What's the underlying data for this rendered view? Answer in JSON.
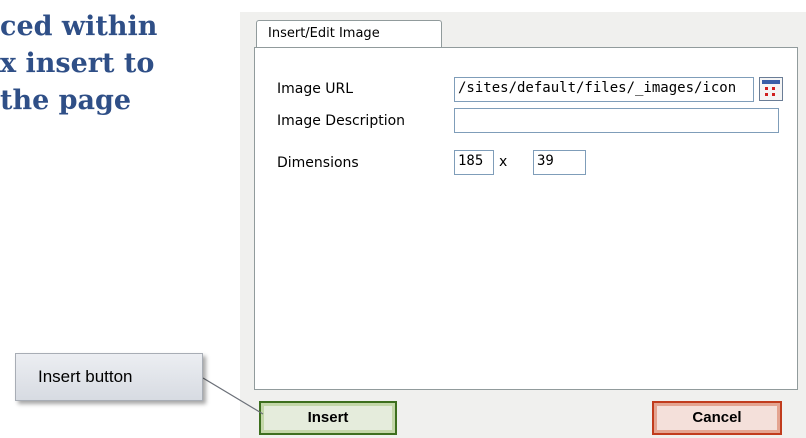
{
  "background_text": {
    "lines": [
      "ced within",
      "x insert to",
      "the page"
    ]
  },
  "dialog": {
    "tab_label": "Insert/Edit Image",
    "image_url": {
      "label": "Image URL",
      "value": "/sites/default/files/_images/icon"
    },
    "image_description": {
      "label": "Image Description",
      "value": ""
    },
    "dimensions": {
      "label": "Dimensions",
      "width": "185",
      "separator": "x",
      "height": "39"
    },
    "browse_icon": "image-browser-icon",
    "insert_label": "Insert",
    "cancel_label": "Cancel"
  },
  "callout": {
    "text": "Insert button"
  },
  "colors": {
    "heading": "#2f4f87",
    "insert_border": "#3d6f1e",
    "cancel_border": "#c13c1d"
  }
}
